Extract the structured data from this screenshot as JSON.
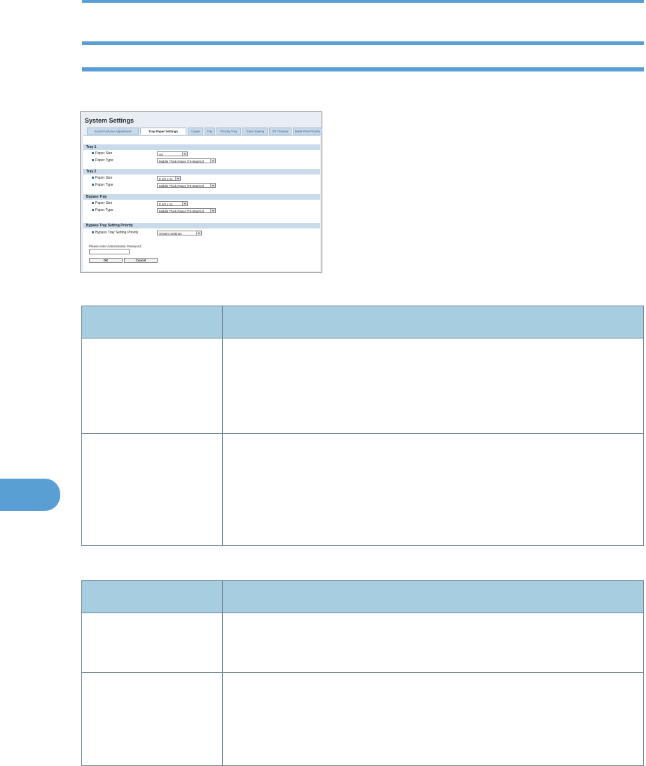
{
  "panel": {
    "title": "System Settings",
    "tabs": [
      {
        "label": "Sound Volume Adjustment",
        "active": false
      },
      {
        "label": "Tray Paper Settings",
        "active": true
      },
      {
        "label": "Copier",
        "active": false
      },
      {
        "label": "Fax",
        "active": false
      },
      {
        "label": "Priority Tray",
        "active": false
      },
      {
        "label": "Toner Saving",
        "active": false
      },
      {
        "label": "I/O Timeout",
        "active": false
      },
      {
        "label": "B&W Print Priority",
        "active": false
      }
    ],
    "sections": [
      {
        "heading": "Tray 1",
        "rows": [
          {
            "label": "Paper Size",
            "value": "A4"
          },
          {
            "label": "Paper Type",
            "value": "Middle Thick Paper (75-90g/m2)"
          }
        ]
      },
      {
        "heading": "Tray 2",
        "rows": [
          {
            "label": "Paper Size",
            "value": "8 1/2 x 11"
          },
          {
            "label": "Paper Type",
            "value": "Middle Thick Paper (75-90g/m2)"
          }
        ]
      },
      {
        "heading": "Bypass Tray",
        "rows": [
          {
            "label": "Paper Size",
            "value": "8 1/2 x 11"
          },
          {
            "label": "Paper Type",
            "value": "Middle Thick Paper (75-90g/m2)"
          }
        ]
      },
      {
        "heading": "Bypass Tray Setting Priority",
        "rows": [
          {
            "label": "Bypass Tray Setting Priority",
            "value": "System Settings"
          }
        ]
      }
    ],
    "password_label": "Please enter Administrator Password:",
    "ok_label": "OK",
    "cancel_label": "Cancel"
  },
  "colors": {
    "accent": "#5a9fd4",
    "table_header": "#a7cde0",
    "panel_bg": "#e8eef4",
    "section_bg": "#c9dbeb"
  }
}
